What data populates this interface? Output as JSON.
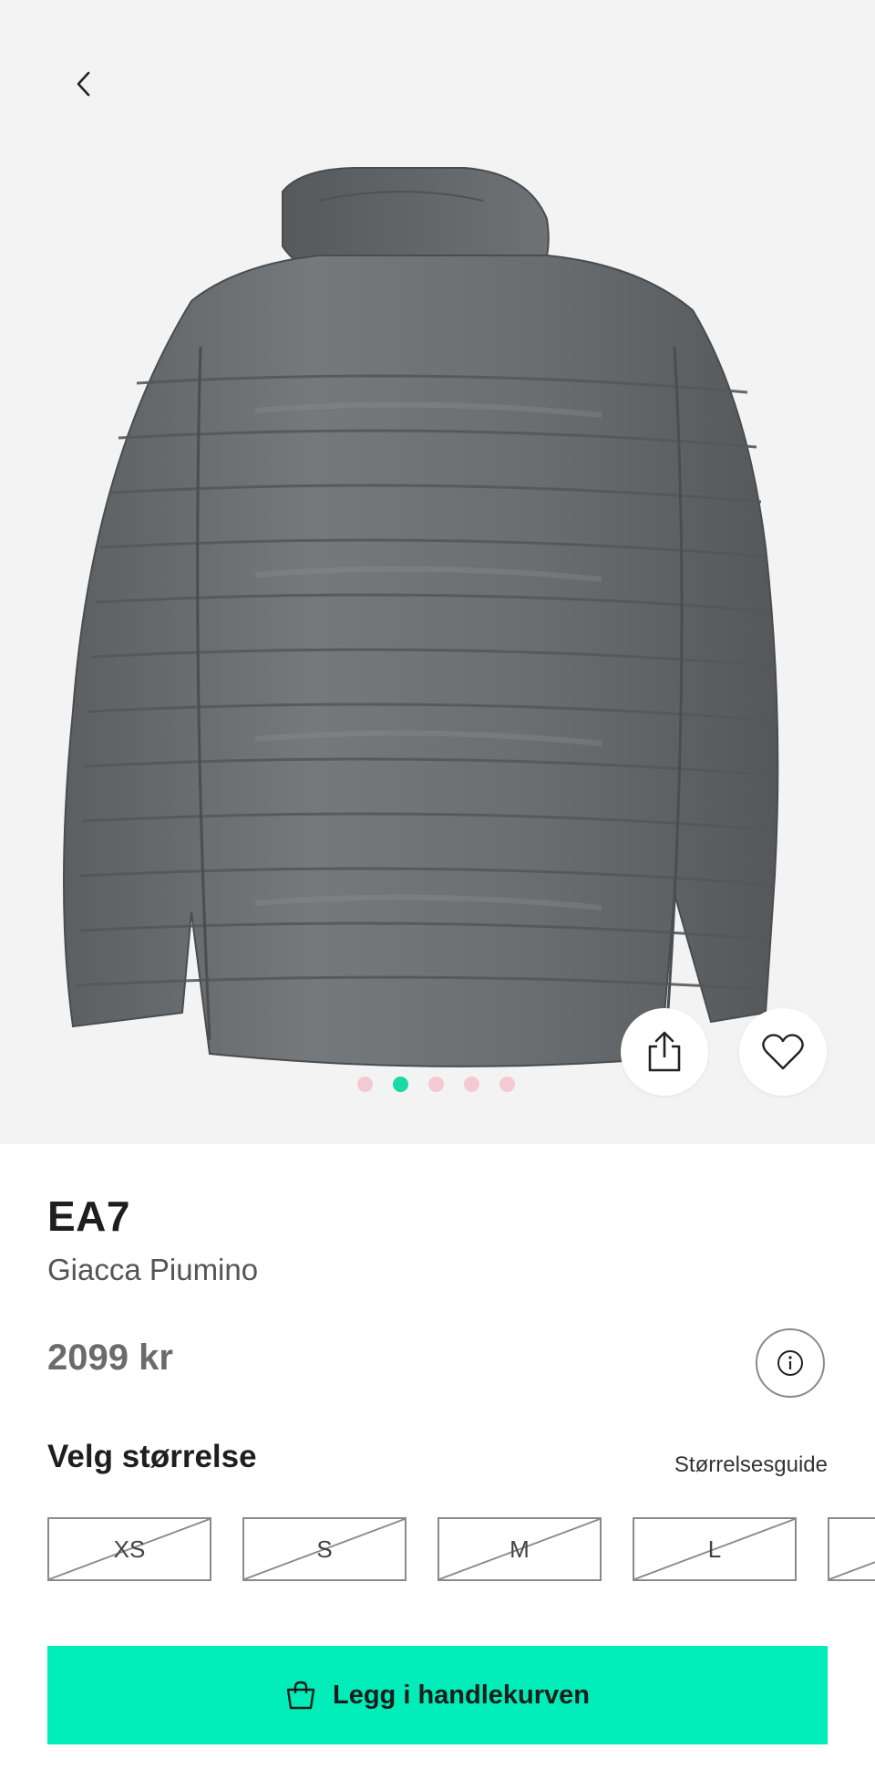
{
  "product": {
    "brand": "EA7",
    "name": "Giacca Piumino",
    "price": "2099 kr"
  },
  "carousel": {
    "total_images": 5,
    "active_index": 1
  },
  "size_section": {
    "heading": "Velg størrelse",
    "guide_link": "Størrelsesguide",
    "sizes": [
      {
        "label": "XS",
        "available": false
      },
      {
        "label": "S",
        "available": false
      },
      {
        "label": "M",
        "available": false
      },
      {
        "label": "L",
        "available": false
      },
      {
        "label": "",
        "available": false
      }
    ]
  },
  "cart_button": {
    "label": "Legg i handlekurven"
  },
  "icons": {
    "back": "chevron-left-icon",
    "share": "share-icon",
    "favorite": "heart-icon",
    "info": "info-icon",
    "cart": "shopping-bag-icon"
  },
  "colors": {
    "accent": "#00ecb8",
    "active_dot": "#19d9a4",
    "inactive_dot": "#f4c9d3"
  }
}
